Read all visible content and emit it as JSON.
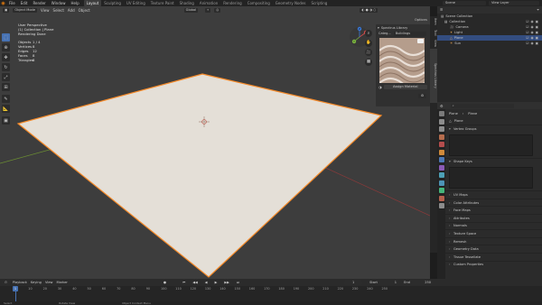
{
  "topbar": {
    "menus": [
      "File",
      "Edit",
      "Render",
      "Window",
      "Help"
    ],
    "workspaces": [
      "Layout",
      "Sculpting",
      "UV Editing",
      "Texture Paint",
      "Shading",
      "Animation",
      "Rendering",
      "Compositing",
      "Geometry Nodes",
      "Scripting"
    ],
    "active_workspace": "Layout",
    "scene": "Scene",
    "view_layer": "View Layer"
  },
  "viewport": {
    "mode": "Object Mode",
    "menus": [
      "View",
      "Select",
      "Add",
      "Object"
    ],
    "transform_orientation": "Global",
    "options_label": "Options",
    "overlay": {
      "line1": "User Perspective",
      "line2": "(1) Collection | Plane",
      "line3": "Rendering Done"
    },
    "stats": [
      {
        "key": "Objects",
        "value": "1 / 4"
      },
      {
        "key": "Vertices",
        "value": "8"
      },
      {
        "key": "Edges",
        "value": "12"
      },
      {
        "key": "Faces",
        "value": "8"
      },
      {
        "key": "Triangles",
        "value": "8"
      }
    ],
    "gizmo": {
      "x": "X",
      "y": "Y",
      "z": "Z"
    }
  },
  "toolbar_icons": [
    "cursor-select",
    "move",
    "rotate",
    "scale",
    "transform",
    "annotate",
    "measure",
    "add-cube"
  ],
  "sidebar_tabs": [
    "Item",
    "Tool",
    "View",
    "Spectrus Library"
  ],
  "spectrus": {
    "title": "Spectrus Library",
    "category_label": "Categ...",
    "category_value": "Buildings",
    "assign_button": "Assign Material"
  },
  "outliner": {
    "title": "Scene Collection",
    "items": [
      {
        "label": "Collection",
        "indent": 0,
        "selected": false
      },
      {
        "label": "Camera",
        "indent": 1,
        "selected": false
      },
      {
        "label": "Light",
        "indent": 1,
        "selected": false
      },
      {
        "label": "Plane",
        "indent": 1,
        "selected": true
      },
      {
        "label": "Sun",
        "indent": 1,
        "selected": false
      }
    ]
  },
  "properties": {
    "object_name": "Plane",
    "data_name": "Plane",
    "sections_top": [
      "Vertex Groups",
      "Shape Keys"
    ],
    "sections": [
      "UV Maps",
      "Color Attributes",
      "Face Maps",
      "Attributes",
      "Normals",
      "Texture Space",
      "Remesh",
      "Geometry Data",
      "Tissue Tessellate",
      "Custom Properties"
    ]
  },
  "timeline": {
    "menus": [
      "Playback",
      "Keying",
      "View",
      "Marker"
    ],
    "current_frame": "1",
    "start_label": "Start",
    "start": "1",
    "end_label": "End",
    "end": "250",
    "ticks": [
      "0",
      "10",
      "20",
      "30",
      "40",
      "50",
      "60",
      "70",
      "80",
      "90",
      "100",
      "110",
      "120",
      "130",
      "140",
      "150",
      "160",
      "170",
      "180",
      "190",
      "200",
      "210",
      "220",
      "230",
      "240",
      "250"
    ]
  },
  "statusbar": {
    "items": [
      "Select",
      "Rotate View",
      "Object Context Menu"
    ]
  },
  "colors": {
    "accent": "#4772b3",
    "selection_outline": "#f58a29",
    "plane": "#e4dfd7",
    "viewport_bg": "#3d3d3d"
  }
}
